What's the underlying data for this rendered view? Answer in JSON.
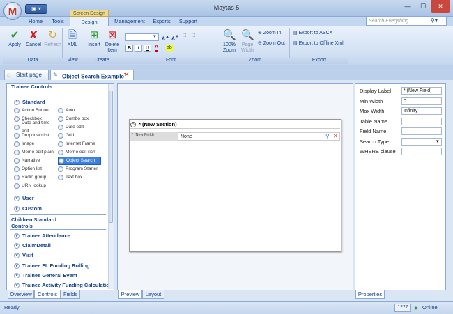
{
  "window": {
    "title": "Maytas 5",
    "context_tab": "Screen Design"
  },
  "qat_icon": "disk-icon",
  "menu": {
    "tabs": [
      "Home",
      "Tools",
      "Design",
      "Management",
      "Exports",
      "Support"
    ]
  },
  "search": {
    "placeholder": "Search Everything..."
  },
  "ribbon": {
    "data": {
      "label": "Data",
      "apply": "Apply",
      "cancel": "Cancel",
      "refresh": "Refresh"
    },
    "view": {
      "label": "View",
      "xml": "XML"
    },
    "create": {
      "label": "Create",
      "insert": "Insert",
      "delete_item": "Delete Item"
    },
    "font": {
      "label": "Font",
      "bold": "B",
      "italic": "I",
      "underline": "U",
      "grow": "A",
      "shrink": "A",
      "font_color": "A",
      "highlight": "ab"
    },
    "zoom": {
      "label": "Zoom",
      "zoom100": "100% Zoom",
      "page_width": "Page Width",
      "zoom_in": "Zoom In",
      "zoom_out": "Zoom Out"
    },
    "export": {
      "label": "Export",
      "ascx": "Export to ASCX",
      "offline_xml": "Export to Offline Xml"
    }
  },
  "doc_tabs": [
    {
      "label": "Start page"
    },
    {
      "label": "Object Search Example",
      "modified": "*"
    }
  ],
  "left_panel": {
    "trainee_title": "Trainee Controls",
    "standard": "Standard",
    "controls_col1": [
      "Action Button",
      "Checkbox",
      "Date and time edit",
      "Dropdown list",
      "Image",
      "Memo edit plain",
      "Narrative",
      "Option list",
      "Radio group",
      "URN lookup"
    ],
    "controls_col2": [
      "Auto",
      "Combo box",
      "Date edit",
      "Grid",
      "Internet Frame",
      "Memo edit rich",
      "Object Search",
      "Program Starter",
      "Text box"
    ],
    "user": "User",
    "custom": "Custom",
    "children_title": "Children Standard Controls",
    "children": [
      "Trainee Attendance",
      "ClaimDetail",
      "Visit",
      "Trainee FL Funding Rolling",
      "Trainee General Event",
      "Trainee Activity Funding Calculation"
    ],
    "bottom_tabs": [
      "Overview",
      "Controls",
      "Fields"
    ]
  },
  "form": {
    "section_title": "* (New Section)",
    "field_label": "* (New Field)",
    "field_value": "None"
  },
  "center_tabs": [
    "Preview",
    "Layout"
  ],
  "properties": {
    "rows": [
      {
        "label": "Display Label",
        "value": "* (New Field)"
      },
      {
        "label": "Min Width",
        "value": "0"
      },
      {
        "label": "Max Width",
        "value": "Infinity"
      },
      {
        "label": "Table Name",
        "value": ""
      },
      {
        "label": "Field Name",
        "value": ""
      },
      {
        "label": "Search Type",
        "value": ""
      },
      {
        "label": "WHERE clause",
        "value": ""
      }
    ],
    "tab": "Properties"
  },
  "status": {
    "left": "Ready",
    "count": "1227",
    "online": "Online"
  }
}
